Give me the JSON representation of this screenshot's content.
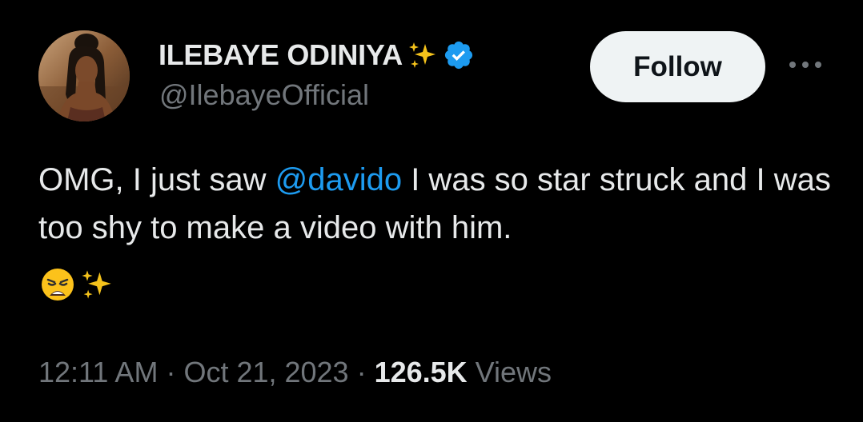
{
  "author": {
    "display_name": "ILEBAYE ODINIYA",
    "handle": "@IlebayeOfficial",
    "verified": true,
    "badge_emoji": "sparkles-icon",
    "verified_color": "#1d9bf0"
  },
  "actions": {
    "follow_label": "Follow"
  },
  "tweet": {
    "text_before": "OMG, I just saw ",
    "mention": "@davido",
    "text_after": " I was so star struck and I was too shy to make a video with him.",
    "emojis": [
      "weary-face-icon",
      "sparkles-icon"
    ]
  },
  "meta": {
    "time": "12:11 AM",
    "sep1": " · ",
    "date": "Oct 21, 2023",
    "sep2": " · ",
    "views_count": "126.5K",
    "views_label": " Views"
  },
  "colors": {
    "background": "#000000",
    "primary_text": "#e7e9ea",
    "secondary_text": "#71767b",
    "link": "#1d9bf0",
    "follow_bg": "#eff3f4"
  }
}
